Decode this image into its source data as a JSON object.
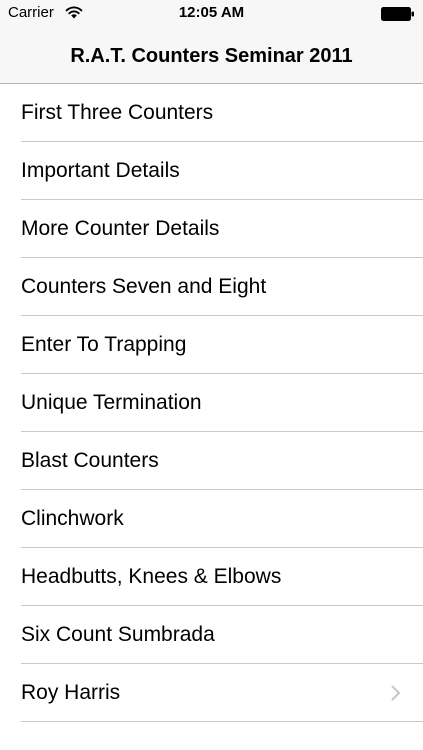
{
  "status_bar": {
    "carrier": "Carrier",
    "time": "12:05 AM",
    "icons": [
      "wifi-icon",
      "battery-icon"
    ]
  },
  "nav_bar": {
    "title": "R.A.T. Counters Seminar 2011"
  },
  "list": {
    "items": [
      {
        "label": "First Three Counters"
      },
      {
        "label": "Important Details"
      },
      {
        "label": "More Counter Details"
      },
      {
        "label": "Counters Seven and Eight"
      },
      {
        "label": "Enter To Trapping"
      },
      {
        "label": "Unique Termination"
      },
      {
        "label": "Blast Counters"
      },
      {
        "label": "Clinchwork"
      },
      {
        "label": "Headbutts, Knees & Elbows"
      },
      {
        "label": "Six Count Sumbrada"
      },
      {
        "label": "Roy Harris",
        "accessory": "chevron-right-icon"
      }
    ]
  },
  "colors": {
    "bar_background": "#f7f7f7",
    "separator": "#c8c7cc",
    "chevron": "#c7c7cc"
  }
}
